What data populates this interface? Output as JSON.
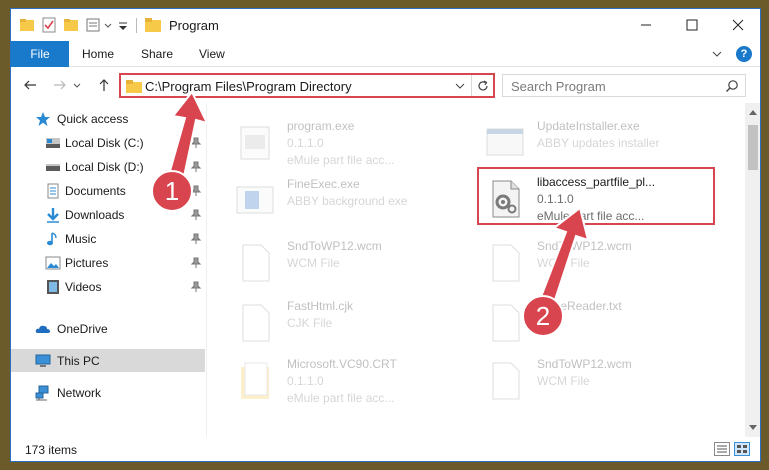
{
  "window": {
    "title": "Program"
  },
  "ribbon": {
    "tabs": [
      "File",
      "Home",
      "Share",
      "View"
    ],
    "help": "?"
  },
  "address": {
    "path": "C:\\Program Files\\Program Directory",
    "search_placeholder": "Search Program"
  },
  "sidebar": {
    "items": [
      {
        "label": "Quick access",
        "icon": "star-icon"
      },
      {
        "label": "Local Disk (C:)",
        "icon": "drive-icon",
        "pinned": true
      },
      {
        "label": "Local Disk (D:)",
        "icon": "drive-icon",
        "pinned": true
      },
      {
        "label": "Documents",
        "icon": "documents-icon",
        "pinned": true
      },
      {
        "label": "Downloads",
        "icon": "downloads-icon",
        "pinned": true
      },
      {
        "label": "Music",
        "icon": "music-icon",
        "pinned": true
      },
      {
        "label": "Pictures",
        "icon": "pictures-icon",
        "pinned": true
      },
      {
        "label": "Videos",
        "icon": "videos-icon",
        "pinned": true
      },
      {
        "label": "OneDrive",
        "icon": "onedrive-icon"
      },
      {
        "label": "This PC",
        "icon": "pc-icon",
        "selected": true
      },
      {
        "label": "Network",
        "icon": "network-icon"
      }
    ]
  },
  "files": [
    {
      "name": "program.exe",
      "line2": "0.1.1.0",
      "line3": "eMule part file acc...",
      "icon": "exe-icon"
    },
    {
      "name": "UpdateInstaller.exe",
      "line2": "ABBY updates installer",
      "line3": "",
      "icon": "installer-icon"
    },
    {
      "name": "FineExec.exe",
      "line2": "ABBY background exe",
      "line3": "",
      "icon": "app-window-icon"
    },
    {
      "name": "libaccess_partfile_pl...",
      "line2": "0.1.1.0",
      "line3": "eMule part file acc...",
      "icon": "settings-file-icon"
    },
    {
      "name": "SndToWP12.wcm",
      "line2": "WCM File",
      "line3": "",
      "icon": "blank-file-icon"
    },
    {
      "name": "SndToWP12.wcm",
      "line2": "WCM File",
      "line3": "",
      "icon": "blank-file-icon"
    },
    {
      "name": "FastHtml.cjk",
      "line2": "CJK File",
      "line3": "",
      "icon": "blank-file-icon"
    },
    {
      "name": "b...neReader.txt",
      "line2": "",
      "line3": "",
      "icon": "blank-file-icon"
    },
    {
      "name": "Microsoft.VC90.CRT",
      "line2": "0.1.1.0",
      "line3": "eMule part file acc...",
      "icon": "folder-icon"
    },
    {
      "name": "SndToWP12.wcm",
      "line2": "WCM File",
      "line3": "",
      "icon": "blank-file-icon"
    }
  ],
  "status": {
    "item_count": "173 items"
  },
  "annotations": {
    "step1": "1",
    "step2": "2",
    "color": "#d9454f"
  }
}
